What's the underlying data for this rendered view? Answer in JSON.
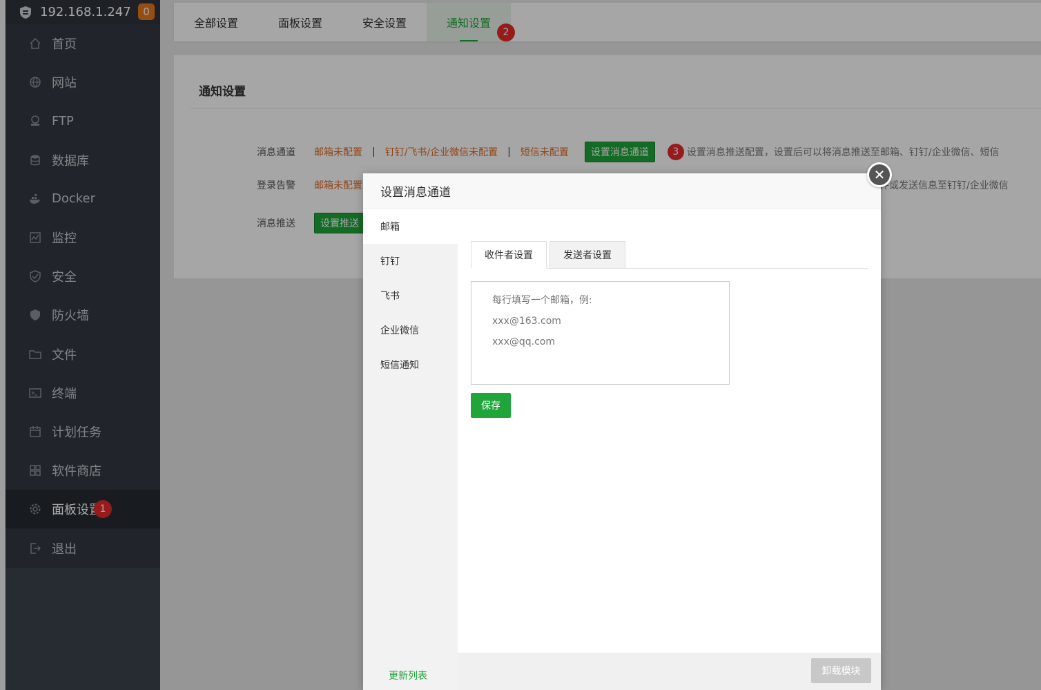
{
  "sidebar": {
    "ip": "192.168.1.247",
    "badge": "0",
    "items": [
      {
        "label": "首页",
        "icon": "home-icon"
      },
      {
        "label": "网站",
        "icon": "globe-icon"
      },
      {
        "label": "FTP",
        "icon": "ftp-icon"
      },
      {
        "label": "数据库",
        "icon": "database-icon"
      },
      {
        "label": "Docker",
        "icon": "docker-icon"
      },
      {
        "label": "监控",
        "icon": "monitor-icon"
      },
      {
        "label": "安全",
        "icon": "shield-check-icon"
      },
      {
        "label": "防火墙",
        "icon": "shield-icon"
      },
      {
        "label": "文件",
        "icon": "folder-icon"
      },
      {
        "label": "终端",
        "icon": "terminal-icon"
      },
      {
        "label": "计划任务",
        "icon": "calendar-icon"
      },
      {
        "label": "软件商店",
        "icon": "grid-icon"
      },
      {
        "label": "面板设置",
        "icon": "gear-icon",
        "marker": "1"
      },
      {
        "label": "退出",
        "icon": "logout-icon"
      }
    ]
  },
  "tabs": {
    "items": [
      "全部设置",
      "面板设置",
      "安全设置",
      "通知设置"
    ],
    "active_marker": "2"
  },
  "panel": {
    "title": "通知设置",
    "row1": {
      "label": "消息通道",
      "email": "邮箱未配置",
      "sep": "|",
      "im": "钉钉/飞书/企业微信未配置",
      "sms": "短信未配置",
      "button": "设置消息通道",
      "marker": "3",
      "desc": "设置消息推送配置，设置后可以将消息推送至邮箱、钉钉/企业微信、短信"
    },
    "row2": {
      "label": "登录告警",
      "email": "邮箱未配置",
      "desc": "件或发送信息至钉钉/企业微信"
    },
    "row3": {
      "label": "消息推送",
      "button": "设置推送"
    }
  },
  "modal": {
    "title": "设置消息通道",
    "close": "✕",
    "side_items": [
      "邮箱",
      "钉钉",
      "飞书",
      "企业微信",
      "短信通知"
    ],
    "update_link": "更新列表",
    "sub_tabs": [
      "收件者设置",
      "发送者设置"
    ],
    "email_placeholder": "每行填写一个邮箱，例:\nxxx@163.com\nxxx@qq.com",
    "save": "保存",
    "unload": "卸载模块"
  },
  "colors": {
    "accent": "#20a53a",
    "warn": "#e26a25",
    "marker": "#e82a2a",
    "sidebar_bg": "#3c444d"
  }
}
